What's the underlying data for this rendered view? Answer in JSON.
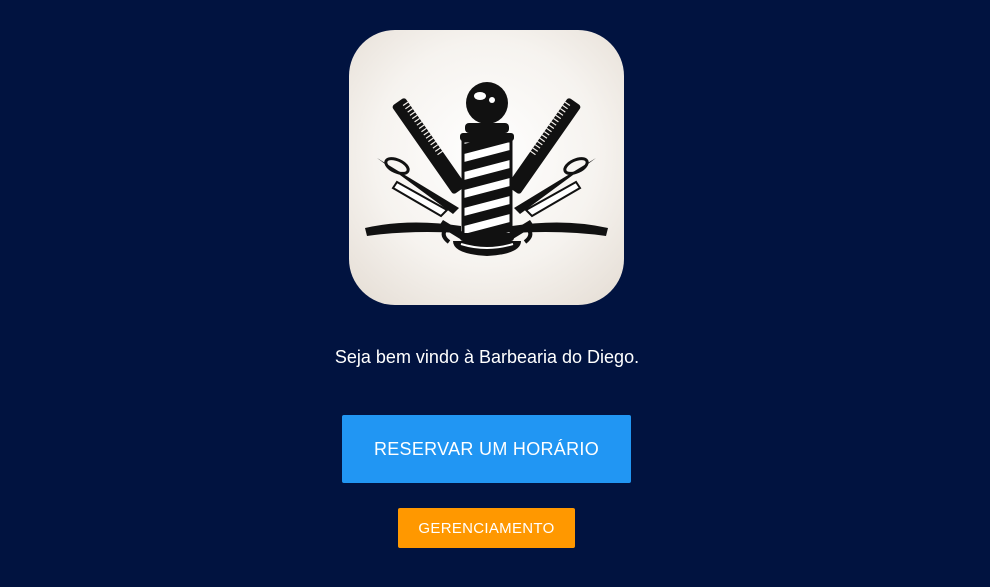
{
  "logo": {
    "icon": "barber-pole-icon"
  },
  "welcome": {
    "text": "Seja bem vindo à Barbearia do Diego."
  },
  "buttons": {
    "reserve_label": "RESERVAR UM HORÁRIO",
    "manage_label": "GERENCIAMENTO"
  },
  "colors": {
    "background": "#011340",
    "reserve_button": "#2196f3",
    "manage_button": "#ff9800",
    "text": "#ffffff"
  }
}
